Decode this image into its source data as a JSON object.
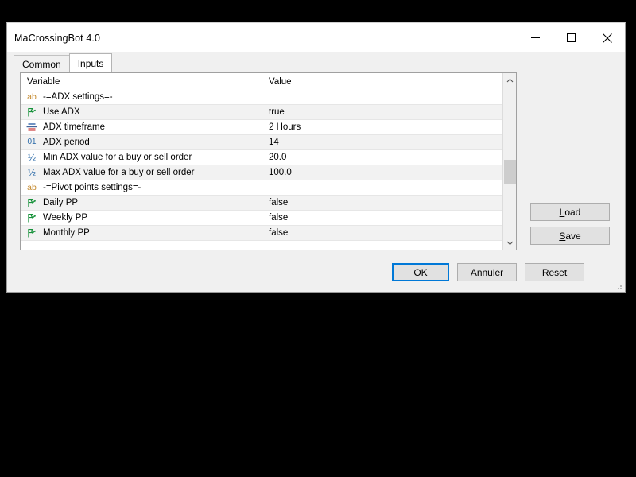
{
  "window": {
    "title": "MaCrossingBot 4.0",
    "controls": {
      "minimize": "minimize-icon",
      "maximize": "maximize-icon",
      "close": "close-icon"
    }
  },
  "tabs": [
    {
      "label": "Common",
      "active": false
    },
    {
      "label": "Inputs",
      "active": true
    }
  ],
  "grid": {
    "columns": [
      "Variable",
      "Value"
    ],
    "rows": [
      {
        "icon": "ab",
        "variable": "-=ADX settings=-",
        "value": "",
        "shade": false
      },
      {
        "icon": "flag",
        "variable": "Use ADX",
        "value": "true",
        "shade": true
      },
      {
        "icon": "tf",
        "variable": "ADX timeframe",
        "value": "2 Hours",
        "shade": false
      },
      {
        "icon": "01",
        "variable": "ADX period",
        "value": "14",
        "shade": true
      },
      {
        "icon": "frac",
        "variable": "Min ADX value for a buy or sell order",
        "value": "20.0",
        "shade": false
      },
      {
        "icon": "frac",
        "variable": "Max ADX value for a buy or sell order",
        "value": "100.0",
        "shade": true
      },
      {
        "icon": "ab",
        "variable": "-=Pivot points settings=-",
        "value": "",
        "shade": false
      },
      {
        "icon": "flag",
        "variable": "Daily PP",
        "value": "false",
        "shade": true
      },
      {
        "icon": "flag",
        "variable": "Weekly PP",
        "value": "false",
        "shade": false
      },
      {
        "icon": "flag",
        "variable": "Monthly PP",
        "value": "false",
        "shade": true
      }
    ]
  },
  "scrollbar": {
    "up_icon": "chevron-up-icon",
    "down_icon": "chevron-down-icon"
  },
  "side_buttons": {
    "load": {
      "accel": "L",
      "rest": "oad"
    },
    "save": {
      "accel": "S",
      "rest": "ave"
    }
  },
  "bottom_buttons": {
    "ok": "OK",
    "cancel": "Annuler",
    "reset": "Reset"
  },
  "colors": {
    "accent": "#0078d7",
    "dialog_bg": "#f0f0f0",
    "grid_bg": "#ffffff",
    "row_shade": "#f2f2f2",
    "icon_ab": "#c58a2e",
    "icon_num": "#2b6aa8",
    "icon_flag": "#17923b"
  }
}
